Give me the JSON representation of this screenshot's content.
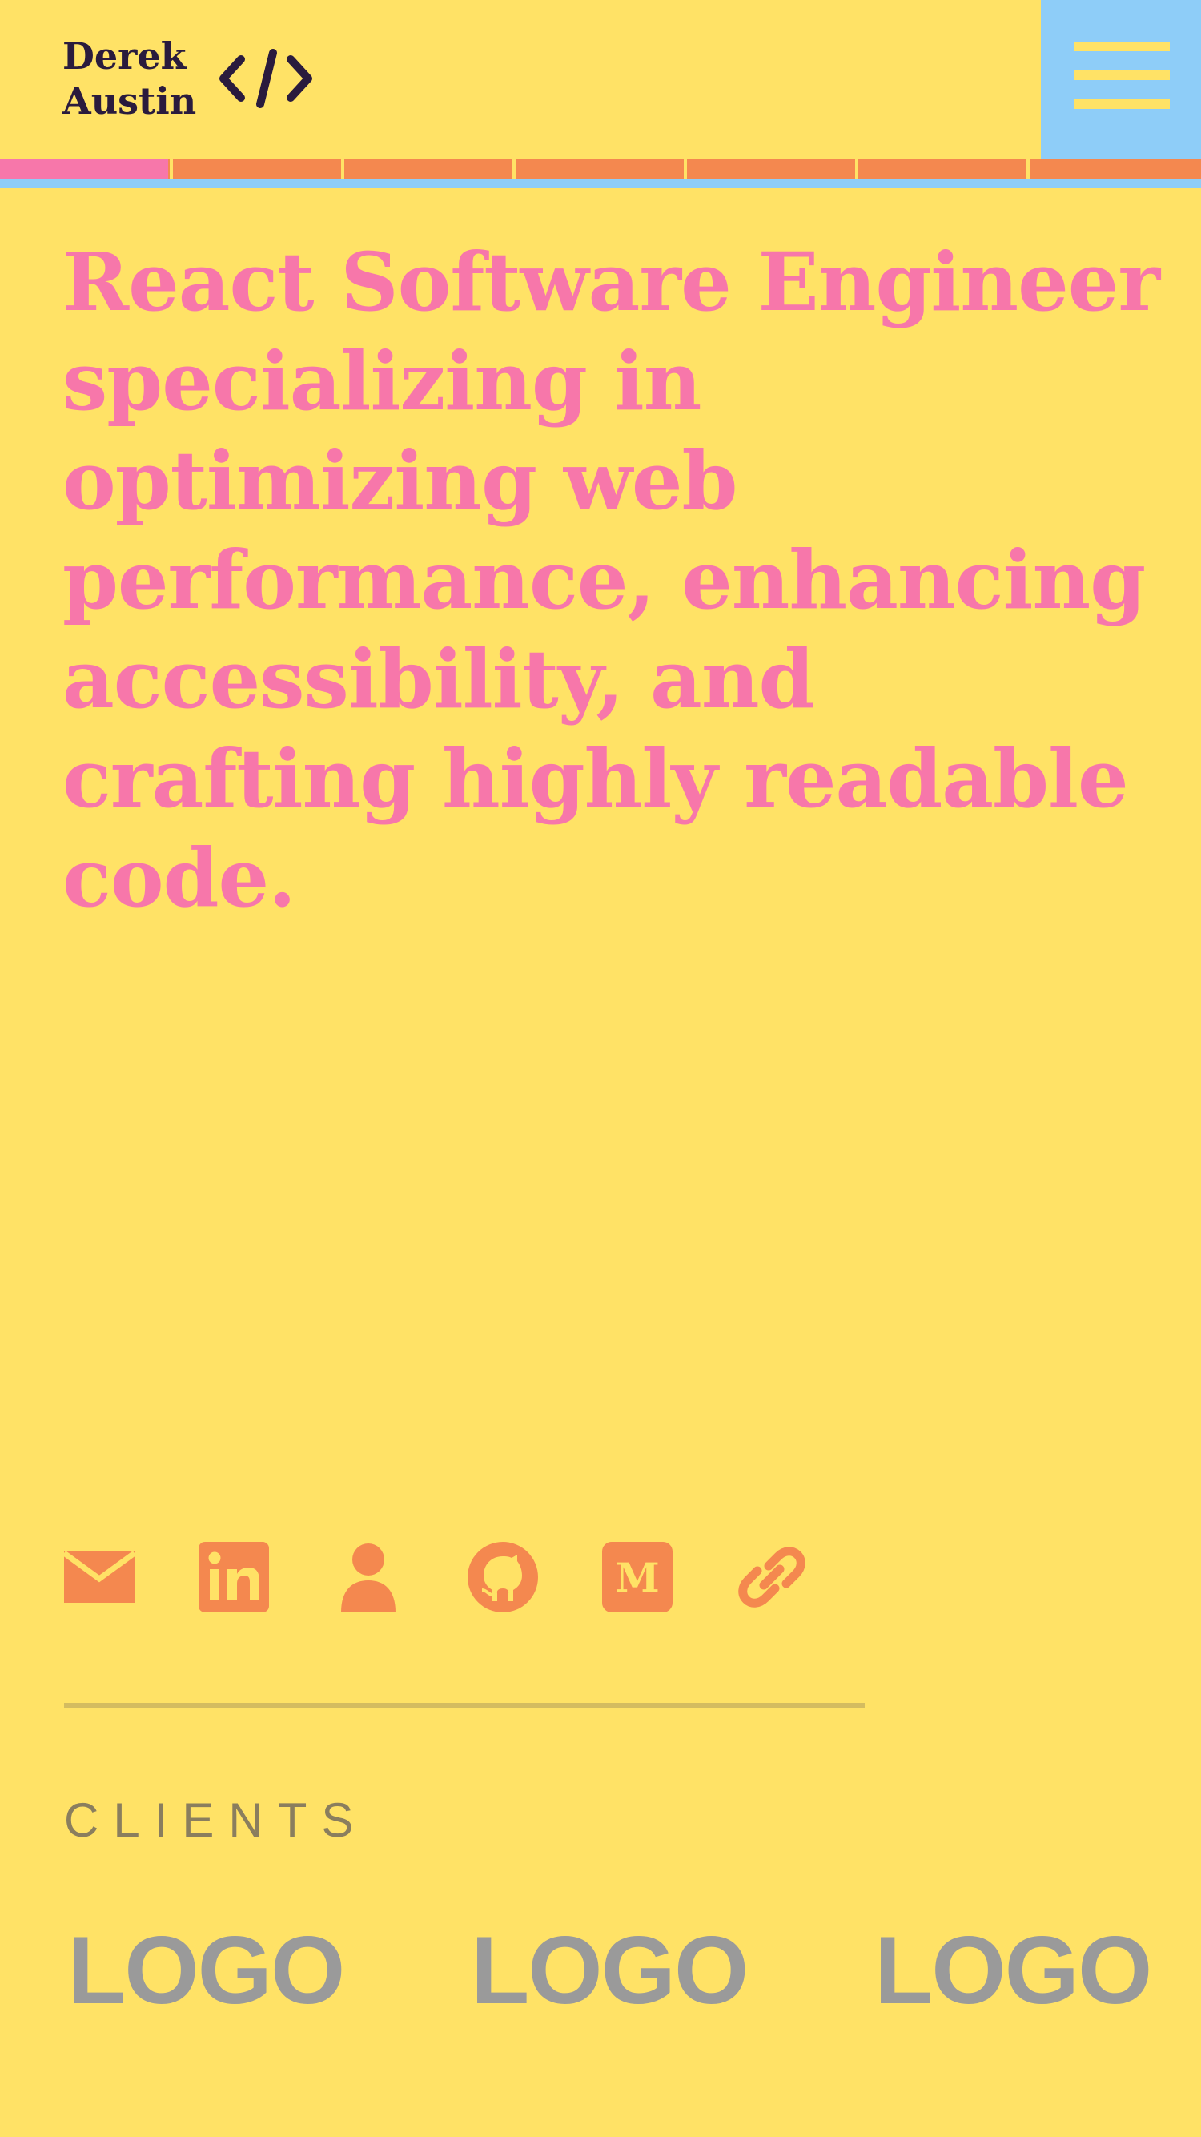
{
  "header": {
    "brand": {
      "first_name": "Derek",
      "last_name": "Austin",
      "icon": "code-brackets-icon"
    },
    "menu_icon": "hamburger-menu-icon"
  },
  "reading_progress": {
    "fraction": 0.14,
    "segments": 7
  },
  "hero": {
    "headline": "React Software Engineer specializing in optimizing web performance, enhancing accessibility, and crafting highly readable code."
  },
  "social_links": [
    {
      "icon": "email-icon"
    },
    {
      "icon": "linkedin-icon"
    },
    {
      "icon": "person-icon"
    },
    {
      "icon": "github-icon"
    },
    {
      "icon": "medium-icon",
      "glyph": "M"
    },
    {
      "icon": "link-icon"
    }
  ],
  "clients": {
    "label": "CLIENTS",
    "logos": [
      "LOGO",
      "LOGO",
      "LOGO"
    ]
  },
  "colors": {
    "background": "#FFE266",
    "headline": "#F777AA",
    "accent_orange": "#F4884F",
    "accent_blue": "#8ECDF8",
    "brand_text": "#2A1B3D",
    "logo_gray": "#9A9A9A"
  }
}
